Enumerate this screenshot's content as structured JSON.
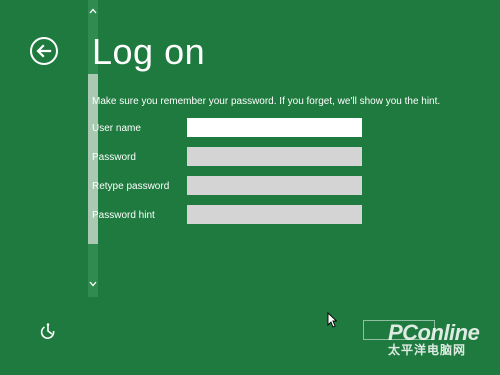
{
  "page": {
    "title": "Log on",
    "instruction": "Make sure you remember your password. If you forget, we'll show you the hint."
  },
  "form": {
    "fields": [
      {
        "label": "User name",
        "value": ""
      },
      {
        "label": "Password",
        "value": ""
      },
      {
        "label": "Retype password",
        "value": ""
      },
      {
        "label": "Password hint",
        "value": ""
      }
    ]
  },
  "watermark": {
    "logo": "PConline",
    "subtitle": "太平洋电脑网"
  },
  "colors": {
    "background": "#1e7a3e",
    "active_field": "#ffffff",
    "inactive_field": "#d4d4d4"
  },
  "icons": {
    "back": "back-arrow-icon",
    "scroll_up": "chevron-up-icon",
    "scroll_down": "chevron-down-icon",
    "ease_of_access": "ease-of-access-icon",
    "cursor": "mouse-cursor-icon"
  }
}
